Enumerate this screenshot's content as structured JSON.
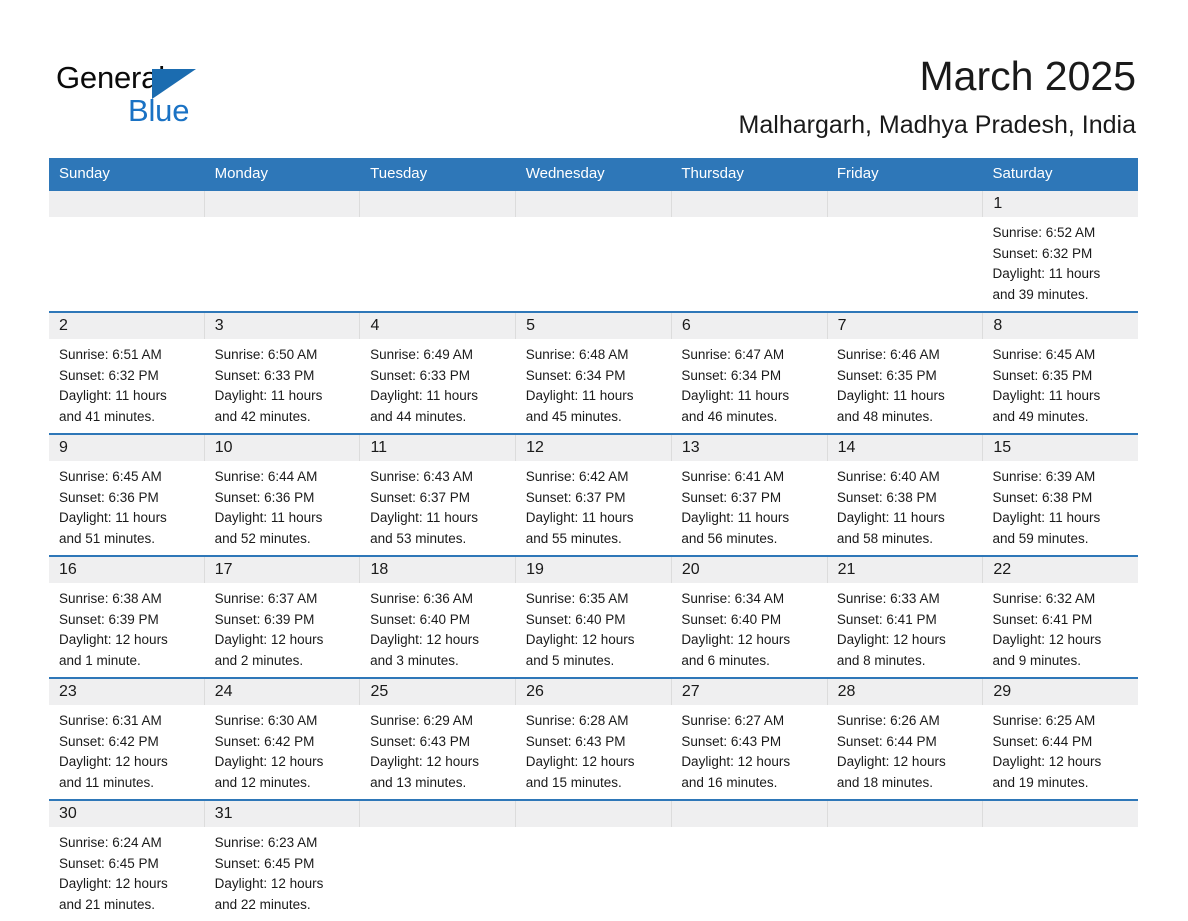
{
  "brand": {
    "name_part1": "General",
    "name_part2": "Blue",
    "triangle_color": "#1b6cb0",
    "blue_color": "#1a72c4"
  },
  "header": {
    "title": "March 2025",
    "subtitle": "Malhargarh, Madhya Pradesh, India"
  },
  "theme": {
    "header_blue": "#2e77b8",
    "day_band_gray": "#efeff0",
    "text_color": "#1a1a1a"
  },
  "calendar": {
    "weekday_headers": [
      "Sunday",
      "Monday",
      "Tuesday",
      "Wednesday",
      "Thursday",
      "Friday",
      "Saturday"
    ],
    "weeks": [
      {
        "numbers": [
          "",
          "",
          "",
          "",
          "",
          "",
          "1"
        ],
        "cells": [
          {
            "sunrise": "",
            "sunset": "",
            "daylight1": "",
            "daylight2": ""
          },
          {
            "sunrise": "",
            "sunset": "",
            "daylight1": "",
            "daylight2": ""
          },
          {
            "sunrise": "",
            "sunset": "",
            "daylight1": "",
            "daylight2": ""
          },
          {
            "sunrise": "",
            "sunset": "",
            "daylight1": "",
            "daylight2": ""
          },
          {
            "sunrise": "",
            "sunset": "",
            "daylight1": "",
            "daylight2": ""
          },
          {
            "sunrise": "",
            "sunset": "",
            "daylight1": "",
            "daylight2": ""
          },
          {
            "sunrise": "Sunrise: 6:52 AM",
            "sunset": "Sunset: 6:32 PM",
            "daylight1": "Daylight: 11 hours",
            "daylight2": "and 39 minutes."
          }
        ]
      },
      {
        "numbers": [
          "2",
          "3",
          "4",
          "5",
          "6",
          "7",
          "8"
        ],
        "cells": [
          {
            "sunrise": "Sunrise: 6:51 AM",
            "sunset": "Sunset: 6:32 PM",
            "daylight1": "Daylight: 11 hours",
            "daylight2": "and 41 minutes."
          },
          {
            "sunrise": "Sunrise: 6:50 AM",
            "sunset": "Sunset: 6:33 PM",
            "daylight1": "Daylight: 11 hours",
            "daylight2": "and 42 minutes."
          },
          {
            "sunrise": "Sunrise: 6:49 AM",
            "sunset": "Sunset: 6:33 PM",
            "daylight1": "Daylight: 11 hours",
            "daylight2": "and 44 minutes."
          },
          {
            "sunrise": "Sunrise: 6:48 AM",
            "sunset": "Sunset: 6:34 PM",
            "daylight1": "Daylight: 11 hours",
            "daylight2": "and 45 minutes."
          },
          {
            "sunrise": "Sunrise: 6:47 AM",
            "sunset": "Sunset: 6:34 PM",
            "daylight1": "Daylight: 11 hours",
            "daylight2": "and 46 minutes."
          },
          {
            "sunrise": "Sunrise: 6:46 AM",
            "sunset": "Sunset: 6:35 PM",
            "daylight1": "Daylight: 11 hours",
            "daylight2": "and 48 minutes."
          },
          {
            "sunrise": "Sunrise: 6:45 AM",
            "sunset": "Sunset: 6:35 PM",
            "daylight1": "Daylight: 11 hours",
            "daylight2": "and 49 minutes."
          }
        ]
      },
      {
        "numbers": [
          "9",
          "10",
          "11",
          "12",
          "13",
          "14",
          "15"
        ],
        "cells": [
          {
            "sunrise": "Sunrise: 6:45 AM",
            "sunset": "Sunset: 6:36 PM",
            "daylight1": "Daylight: 11 hours",
            "daylight2": "and 51 minutes."
          },
          {
            "sunrise": "Sunrise: 6:44 AM",
            "sunset": "Sunset: 6:36 PM",
            "daylight1": "Daylight: 11 hours",
            "daylight2": "and 52 minutes."
          },
          {
            "sunrise": "Sunrise: 6:43 AM",
            "sunset": "Sunset: 6:37 PM",
            "daylight1": "Daylight: 11 hours",
            "daylight2": "and 53 minutes."
          },
          {
            "sunrise": "Sunrise: 6:42 AM",
            "sunset": "Sunset: 6:37 PM",
            "daylight1": "Daylight: 11 hours",
            "daylight2": "and 55 minutes."
          },
          {
            "sunrise": "Sunrise: 6:41 AM",
            "sunset": "Sunset: 6:37 PM",
            "daylight1": "Daylight: 11 hours",
            "daylight2": "and 56 minutes."
          },
          {
            "sunrise": "Sunrise: 6:40 AM",
            "sunset": "Sunset: 6:38 PM",
            "daylight1": "Daylight: 11 hours",
            "daylight2": "and 58 minutes."
          },
          {
            "sunrise": "Sunrise: 6:39 AM",
            "sunset": "Sunset: 6:38 PM",
            "daylight1": "Daylight: 11 hours",
            "daylight2": "and 59 minutes."
          }
        ]
      },
      {
        "numbers": [
          "16",
          "17",
          "18",
          "19",
          "20",
          "21",
          "22"
        ],
        "cells": [
          {
            "sunrise": "Sunrise: 6:38 AM",
            "sunset": "Sunset: 6:39 PM",
            "daylight1": "Daylight: 12 hours",
            "daylight2": "and 1 minute."
          },
          {
            "sunrise": "Sunrise: 6:37 AM",
            "sunset": "Sunset: 6:39 PM",
            "daylight1": "Daylight: 12 hours",
            "daylight2": "and 2 minutes."
          },
          {
            "sunrise": "Sunrise: 6:36 AM",
            "sunset": "Sunset: 6:40 PM",
            "daylight1": "Daylight: 12 hours",
            "daylight2": "and 3 minutes."
          },
          {
            "sunrise": "Sunrise: 6:35 AM",
            "sunset": "Sunset: 6:40 PM",
            "daylight1": "Daylight: 12 hours",
            "daylight2": "and 5 minutes."
          },
          {
            "sunrise": "Sunrise: 6:34 AM",
            "sunset": "Sunset: 6:40 PM",
            "daylight1": "Daylight: 12 hours",
            "daylight2": "and 6 minutes."
          },
          {
            "sunrise": "Sunrise: 6:33 AM",
            "sunset": "Sunset: 6:41 PM",
            "daylight1": "Daylight: 12 hours",
            "daylight2": "and 8 minutes."
          },
          {
            "sunrise": "Sunrise: 6:32 AM",
            "sunset": "Sunset: 6:41 PM",
            "daylight1": "Daylight: 12 hours",
            "daylight2": "and 9 minutes."
          }
        ]
      },
      {
        "numbers": [
          "23",
          "24",
          "25",
          "26",
          "27",
          "28",
          "29"
        ],
        "cells": [
          {
            "sunrise": "Sunrise: 6:31 AM",
            "sunset": "Sunset: 6:42 PM",
            "daylight1": "Daylight: 12 hours",
            "daylight2": "and 11 minutes."
          },
          {
            "sunrise": "Sunrise: 6:30 AM",
            "sunset": "Sunset: 6:42 PM",
            "daylight1": "Daylight: 12 hours",
            "daylight2": "and 12 minutes."
          },
          {
            "sunrise": "Sunrise: 6:29 AM",
            "sunset": "Sunset: 6:43 PM",
            "daylight1": "Daylight: 12 hours",
            "daylight2": "and 13 minutes."
          },
          {
            "sunrise": "Sunrise: 6:28 AM",
            "sunset": "Sunset: 6:43 PM",
            "daylight1": "Daylight: 12 hours",
            "daylight2": "and 15 minutes."
          },
          {
            "sunrise": "Sunrise: 6:27 AM",
            "sunset": "Sunset: 6:43 PM",
            "daylight1": "Daylight: 12 hours",
            "daylight2": "and 16 minutes."
          },
          {
            "sunrise": "Sunrise: 6:26 AM",
            "sunset": "Sunset: 6:44 PM",
            "daylight1": "Daylight: 12 hours",
            "daylight2": "and 18 minutes."
          },
          {
            "sunrise": "Sunrise: 6:25 AM",
            "sunset": "Sunset: 6:44 PM",
            "daylight1": "Daylight: 12 hours",
            "daylight2": "and 19 minutes."
          }
        ]
      },
      {
        "numbers": [
          "30",
          "31",
          "",
          "",
          "",
          "",
          ""
        ],
        "cells": [
          {
            "sunrise": "Sunrise: 6:24 AM",
            "sunset": "Sunset: 6:45 PM",
            "daylight1": "Daylight: 12 hours",
            "daylight2": "and 21 minutes."
          },
          {
            "sunrise": "Sunrise: 6:23 AM",
            "sunset": "Sunset: 6:45 PM",
            "daylight1": "Daylight: 12 hours",
            "daylight2": "and 22 minutes."
          },
          {
            "sunrise": "",
            "sunset": "",
            "daylight1": "",
            "daylight2": ""
          },
          {
            "sunrise": "",
            "sunset": "",
            "daylight1": "",
            "daylight2": ""
          },
          {
            "sunrise": "",
            "sunset": "",
            "daylight1": "",
            "daylight2": ""
          },
          {
            "sunrise": "",
            "sunset": "",
            "daylight1": "",
            "daylight2": ""
          },
          {
            "sunrise": "",
            "sunset": "",
            "daylight1": "",
            "daylight2": ""
          }
        ]
      }
    ]
  }
}
